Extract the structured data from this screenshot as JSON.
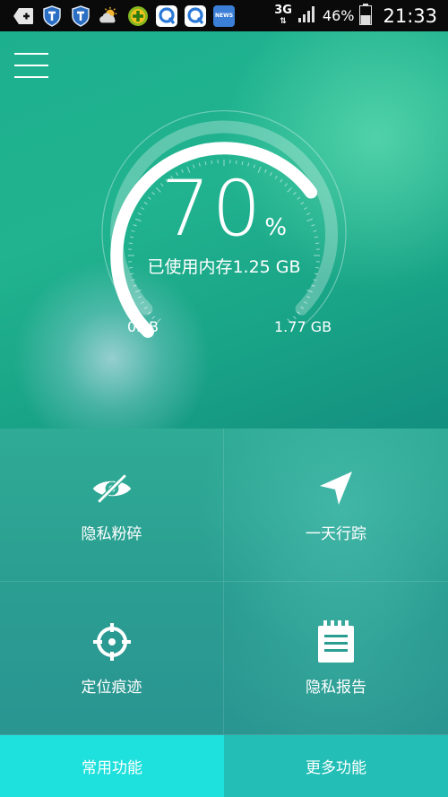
{
  "status_bar": {
    "network": "3G",
    "battery_text": "46%",
    "time": "21:33",
    "icons": [
      "back-icon",
      "shield-icon",
      "shield-icon",
      "weather-icon",
      "plus-icon",
      "q-icon",
      "q-icon",
      "news-icon",
      "signal-icon",
      "battery-icon"
    ],
    "news_label": "NEWS"
  },
  "header": {
    "menu_icon": "hamburger-menu-icon"
  },
  "memory": {
    "percent": "70",
    "percent_unit": "%",
    "used_text": "已使用内存1.25 GB",
    "min_label": "0MB",
    "max_label": "1.77 GB",
    "fraction": 0.7
  },
  "grid": {
    "items": [
      {
        "label": "隐私粉碎",
        "icon": "eye-slash-icon"
      },
      {
        "label": "一天行踪",
        "icon": "navigation-arrow-icon"
      },
      {
        "label": "定位痕迹",
        "icon": "crosshair-icon"
      },
      {
        "label": "隐私报告",
        "icon": "notepad-icon"
      }
    ]
  },
  "tabs": [
    {
      "label": "常用功能",
      "active": true
    },
    {
      "label": "更多功能",
      "active": false
    }
  ],
  "colors": {
    "active_tab": "#1ee0dc",
    "inactive_tab": "#23bfb6",
    "status_bar": "#0a0a0a"
  }
}
